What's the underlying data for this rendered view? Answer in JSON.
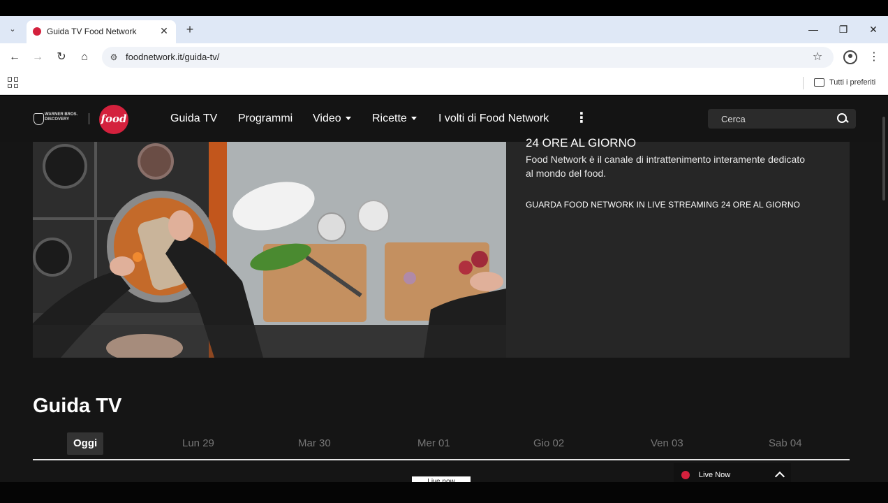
{
  "browser": {
    "tab_title": "Guida TV Food Network",
    "url": "foodnetwork.it/guida-tv/",
    "bookmarks_folder": "Tutti i preferiti"
  },
  "site": {
    "wbd_logo_line1": "WARNER BROS.",
    "wbd_logo_line2": "DISCOVERY",
    "brand_logo": "food",
    "brand_color": "#d4213d",
    "nav": [
      {
        "label": "Guida TV"
      },
      {
        "label": "Programmi"
      },
      {
        "label": "Video"
      },
      {
        "label": "Ricette"
      },
      {
        "label": "I volti di Food Network"
      }
    ],
    "search_placeholder": "Cerca"
  },
  "hero": {
    "heading": "24 ORE AL GIORNO",
    "description": "Food Network è il canale di intrattenimento interamente dedicato al mondo del food.",
    "cta": "GUARDA FOOD NETWORK IN LIVE STREAMING 24 ORE AL GIORNO"
  },
  "guide": {
    "title": "Guida TV",
    "days": [
      "Oggi",
      "Lun 29",
      "Mar 30",
      "Mer 01",
      "Gio 02",
      "Ven 03",
      "Sab 04"
    ]
  },
  "live": {
    "bar_label": "Live Now",
    "tag_label": "Live now"
  }
}
